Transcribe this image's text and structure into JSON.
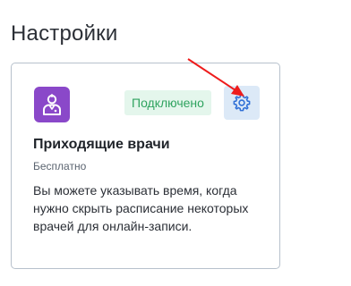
{
  "page": {
    "title": "Настройки"
  },
  "integration_card": {
    "icon": "doctor-icon",
    "status": "Подключено",
    "title": "Приходящие врачи",
    "price": "Бесплатно",
    "description": "Вы можете указывать время, когда нужно скрыть расписание некоторых врачей для онлайн-записи.",
    "settings_icon": "gear-icon"
  },
  "colors": {
    "app_icon_bg": "#8a48c9",
    "status_bg": "#e4f6ec",
    "status_text": "#2fa35f",
    "settings_button_bg": "#dce9f7",
    "settings_icon": "#2f6fd6",
    "annotation_arrow": "#ee1c1c"
  }
}
